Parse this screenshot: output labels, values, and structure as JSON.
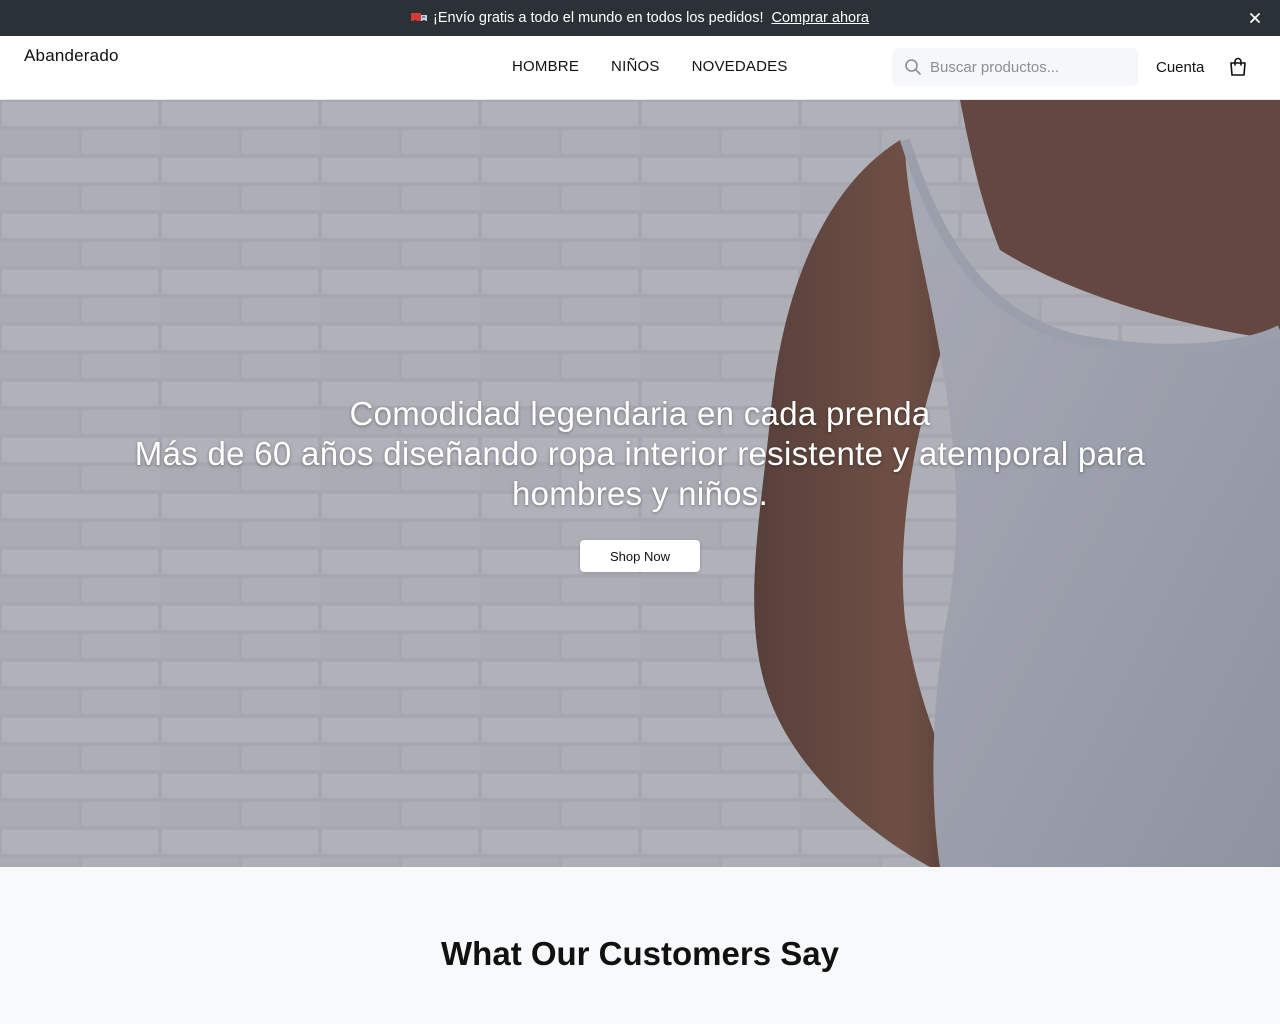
{
  "announcement": {
    "icon": "truck-icon",
    "text": "¡Envío gratis a todo el mundo en todos los pedidos!",
    "link": "Comprar ahora",
    "close_icon": "close-icon"
  },
  "header": {
    "logo": "Abanderado",
    "nav": [
      {
        "label": "HOMBRE"
      },
      {
        "label": "NIÑOS"
      },
      {
        "label": "NOVEDADES"
      }
    ],
    "search": {
      "placeholder": "Buscar productos...",
      "value": "",
      "icon": "search-icon"
    },
    "account": "Cuenta",
    "cart_icon": "shopping-bag-icon"
  },
  "hero": {
    "title": "Comodidad legendaria en cada prenda",
    "subtitle": "Más de 60 años diseñando ropa interior resistente y atemporal para hombres y niños.",
    "cta": "Shop Now"
  },
  "testimonials": {
    "heading": "What Our Customers Say"
  },
  "colors": {
    "announcement_bg": "#2a3137",
    "page_bg": "#ffffff",
    "section_bg": "#f8f9fb",
    "text": "#111111"
  }
}
